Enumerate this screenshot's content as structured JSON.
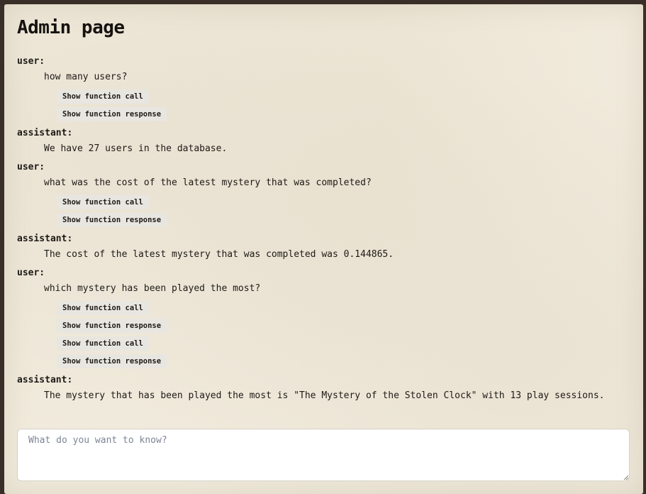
{
  "page": {
    "title": "Admin page"
  },
  "conversation": [
    {
      "role": "user:",
      "text": "how many users?",
      "buttons": [
        "Show function call",
        "Show function response"
      ]
    },
    {
      "role": "assistant:",
      "text": "We have 27 users in the database.",
      "buttons": []
    },
    {
      "role": "user:",
      "text": "what was the cost of the latest mystery that was completed?",
      "buttons": [
        "Show function call",
        "Show function response"
      ]
    },
    {
      "role": "assistant:",
      "text": "The cost of the latest mystery that was completed was 0.144865.",
      "buttons": []
    },
    {
      "role": "user:",
      "text": "which mystery has been played the most?",
      "buttons": [
        "Show function call",
        "Show function response",
        "Show function call",
        "Show function response"
      ]
    },
    {
      "role": "assistant:",
      "text": "The mystery that has been played the most is \"The Mystery of the Stolen Clock\" with 13 play sessions.",
      "buttons": []
    }
  ],
  "query_input": {
    "value": "",
    "placeholder": "What do you want to know?"
  }
}
